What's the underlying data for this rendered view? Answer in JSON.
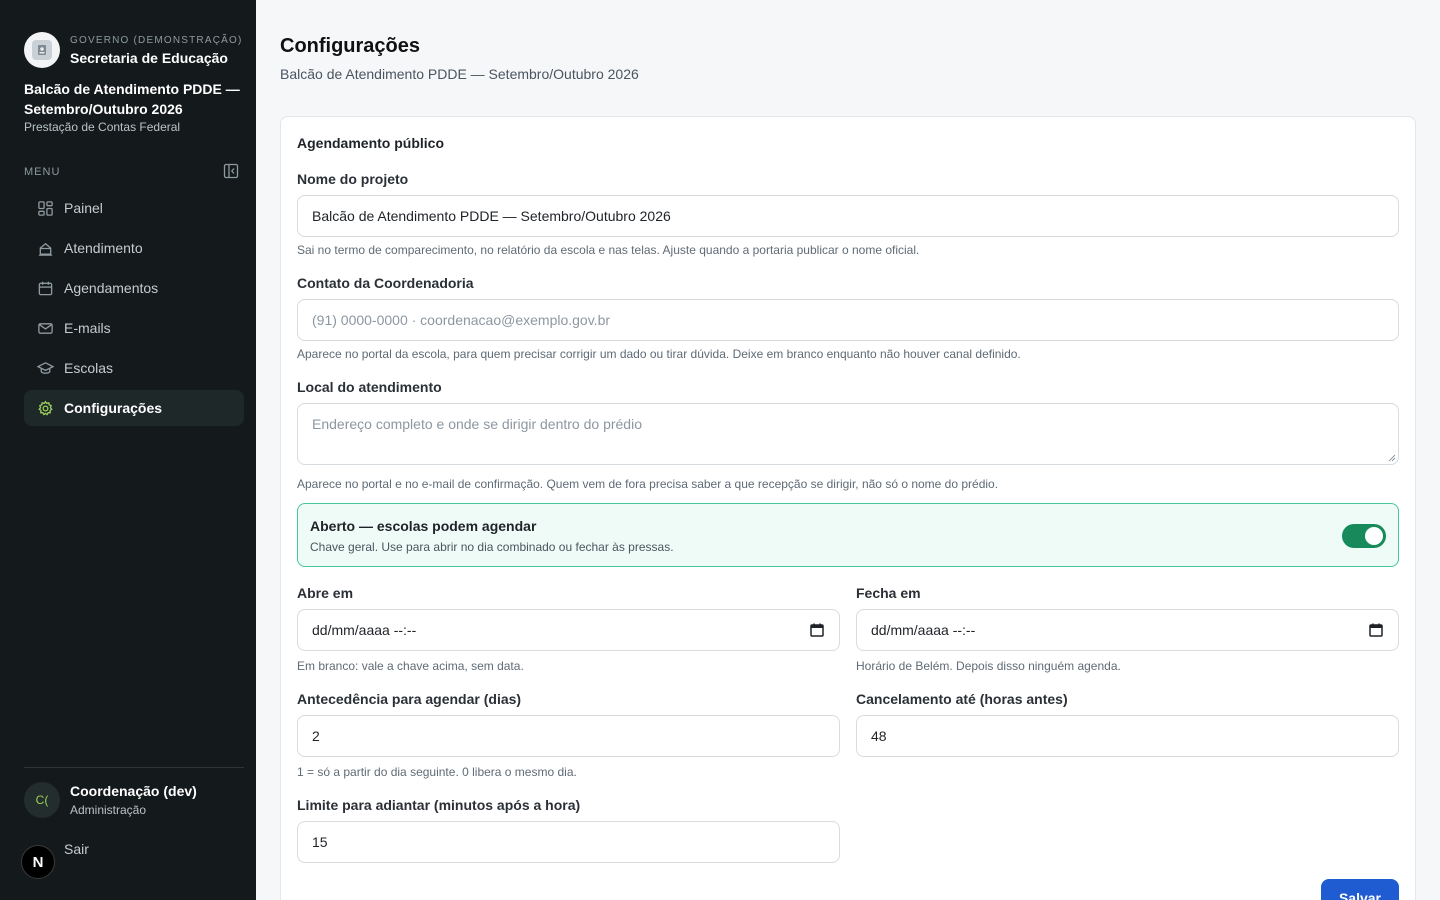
{
  "sidebar": {
    "gov_label": "GOVERNO (DEMONSTRAÇÃO)",
    "secretaria": "Secretaria de Educação",
    "project_title": "Balcão de Atendimento PDDE — Setembro/Outubro 2026",
    "project_subtitle": "Prestação de Contas Federal",
    "menu_label": "MENU",
    "items": [
      {
        "label": "Painel",
        "icon": "dashboard-icon"
      },
      {
        "label": "Atendimento",
        "icon": "desk-icon"
      },
      {
        "label": "Agendamentos",
        "icon": "calendar-icon"
      },
      {
        "label": "E-mails",
        "icon": "mail-icon"
      },
      {
        "label": "Escolas",
        "icon": "graduation-cap-icon"
      },
      {
        "label": "Configurações",
        "icon": "gear-icon",
        "active": true
      }
    ],
    "user": {
      "initials": "C(",
      "name": "Coordenação (dev)",
      "role": "Administração"
    },
    "logout": "Sair",
    "badge": "N"
  },
  "header": {
    "title": "Configurações",
    "subtitle": "Balcão de Atendimento PDDE — Setembro/Outubro 2026"
  },
  "form": {
    "section_title": "Agendamento público",
    "project_name": {
      "label": "Nome do projeto",
      "value": "Balcão de Atendimento PDDE — Setembro/Outubro 2026",
      "help": "Sai no termo de comparecimento, no relatório da escola e nas telas. Ajuste quando a portaria publicar o nome oficial."
    },
    "contact": {
      "label": "Contato da Coordenadoria",
      "placeholder": "(91) 0000-0000 · coordenacao@exemplo.gov.br",
      "help": "Aparece no portal da escola, para quem precisar corrigir um dado ou tirar dúvida. Deixe em branco enquanto não houver canal definido."
    },
    "location": {
      "label": "Local do atendimento",
      "placeholder": "Endereço completo e onde se dirigir dentro do prédio",
      "help": "Aparece no portal e no e-mail de confirmação. Quem vem de fora precisa saber a que recepção se dirigir, não só o nome do prédio."
    },
    "open_toggle": {
      "title": "Aberto — escolas podem agendar",
      "description": "Chave geral. Use para abrir no dia combinado ou fechar às pressas.",
      "on": true
    },
    "opens_at": {
      "label": "Abre em",
      "value": "dd/mm/aaaa --:--",
      "help": "Em branco: vale a chave acima, sem data."
    },
    "closes_at": {
      "label": "Fecha em",
      "value": "dd/mm/aaaa --:--",
      "help": "Horário de Belém. Depois disso ninguém agenda."
    },
    "advance_days": {
      "label": "Antecedência para agendar (dias)",
      "value": "2",
      "help": "1 = só a partir do dia seguinte. 0 libera o mesmo dia."
    },
    "cancel_hours": {
      "label": "Cancelamento até (horas antes)",
      "value": "48"
    },
    "early_limit": {
      "label": "Limite para adiantar (minutos após a hora)",
      "value": "15"
    },
    "save_label": "Salvar"
  },
  "colors": {
    "sidebar_bg": "#141a1b",
    "accent_green": "#168a5b",
    "active_icon": "#9bd15a",
    "primary_blue": "#1f5bd1"
  }
}
